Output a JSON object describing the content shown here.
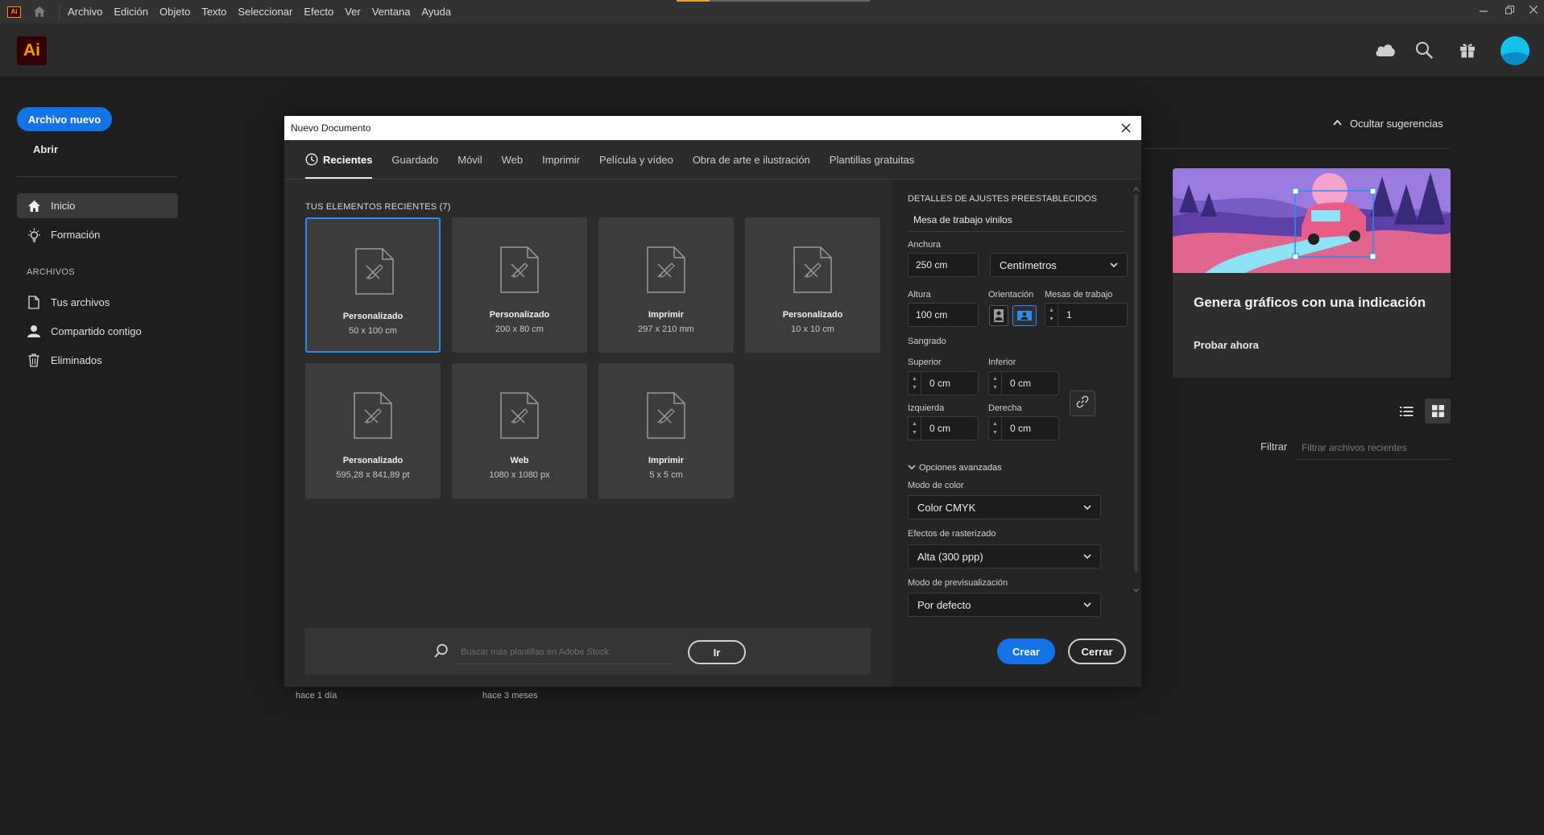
{
  "menubar": {
    "logo": "Ai",
    "items": [
      "Archivo",
      "Edición",
      "Objeto",
      "Texto",
      "Seleccionar",
      "Efecto",
      "Ver",
      "Ventana",
      "Ayuda"
    ],
    "progress_fraction": 0.17
  },
  "header": {
    "app_logo": "Ai",
    "icons": [
      "cloud-icon",
      "search-icon",
      "gift-icon",
      "avatar"
    ]
  },
  "sidebar": {
    "new_file": "Archivo nuevo",
    "open": "Abrir",
    "nav": [
      {
        "label": "Inicio",
        "icon": "home-icon",
        "active": true
      },
      {
        "label": "Formación",
        "icon": "lightbulb-icon",
        "active": false
      }
    ],
    "section_title": "ARCHIVOS",
    "files_nav": [
      {
        "label": "Tus archivos",
        "icon": "file-icon"
      },
      {
        "label": "Compartido contigo",
        "icon": "person-icon"
      },
      {
        "label": "Eliminados",
        "icon": "trash-icon"
      }
    ]
  },
  "right_panel": {
    "hide_suggestions": "Ocultar sugerencias",
    "promo_title": "Genera gráficos con una indicación",
    "promo_link": "Probar ahora",
    "filter_label": "Filtrar",
    "filter_placeholder": "Filtrar archivos recientes",
    "times": [
      "hace 1 día",
      "hace 3 meses"
    ]
  },
  "modal": {
    "title": "Nuevo Documento",
    "tabs": [
      "Recientes",
      "Guardado",
      "Móvil",
      "Web",
      "Imprimir",
      "Película y vídeo",
      "Obra de arte e ilustración",
      "Plantillas gratuitas"
    ],
    "active_tab": 0,
    "recent_heading": "TUS ELEMENTOS RECIENTES",
    "recent_count": "(7)",
    "tiles": [
      {
        "name": "Personalizado",
        "dims": "50 x 100 cm",
        "selected": true
      },
      {
        "name": "Personalizado",
        "dims": "200 x 80 cm",
        "selected": false
      },
      {
        "name": "Imprimir",
        "dims": "297 x 210 mm",
        "selected": false
      },
      {
        "name": "Personalizado",
        "dims": "10 x 10 cm",
        "selected": false
      },
      {
        "name": "Personalizado",
        "dims": "595,28 x 841,89 pt",
        "selected": false
      },
      {
        "name": "Web",
        "dims": "1080 x 1080 px",
        "selected": false
      },
      {
        "name": "Imprimir",
        "dims": "5 x 5 cm",
        "selected": false
      }
    ],
    "search_placeholder": "Buscar más plantillas en Adobe Stock",
    "go_button": "Ir",
    "preset": {
      "heading": "DETALLES DE AJUSTES PREESTABLECIDOS",
      "name": "Mesa de trabajo vinilos",
      "width_label": "Anchura",
      "width_value": "250 cm",
      "units": "Centímetros",
      "height_label": "Altura",
      "height_value": "100 cm",
      "orientation_label": "Orientación",
      "orientation_selected": "landscape",
      "artboards_label": "Mesas de trabajo",
      "artboards_value": "1",
      "bleed_label": "Sangrado",
      "top_label": "Superior",
      "top_value": "0 cm",
      "bottom_label": "Inferior",
      "bottom_value": "0 cm",
      "left_label": "Izquierda",
      "left_value": "0 cm",
      "right_label": "Derecha",
      "right_value": "0 cm",
      "advanced_label": "Opciones avanzadas",
      "color_mode_label": "Modo de color",
      "color_mode_value": "Color CMYK",
      "raster_label": "Efectos de rasterizado",
      "raster_value": "Alta (300 ppp)",
      "preview_label": "Modo de previsualización",
      "preview_value": "Por defecto",
      "create_button": "Crear",
      "close_button": "Cerrar"
    }
  },
  "colors": {
    "accent": "#1473e6",
    "selection": "#2d8ceb",
    "ai_brand": "#ff9a00",
    "ai_bg": "#330000"
  }
}
